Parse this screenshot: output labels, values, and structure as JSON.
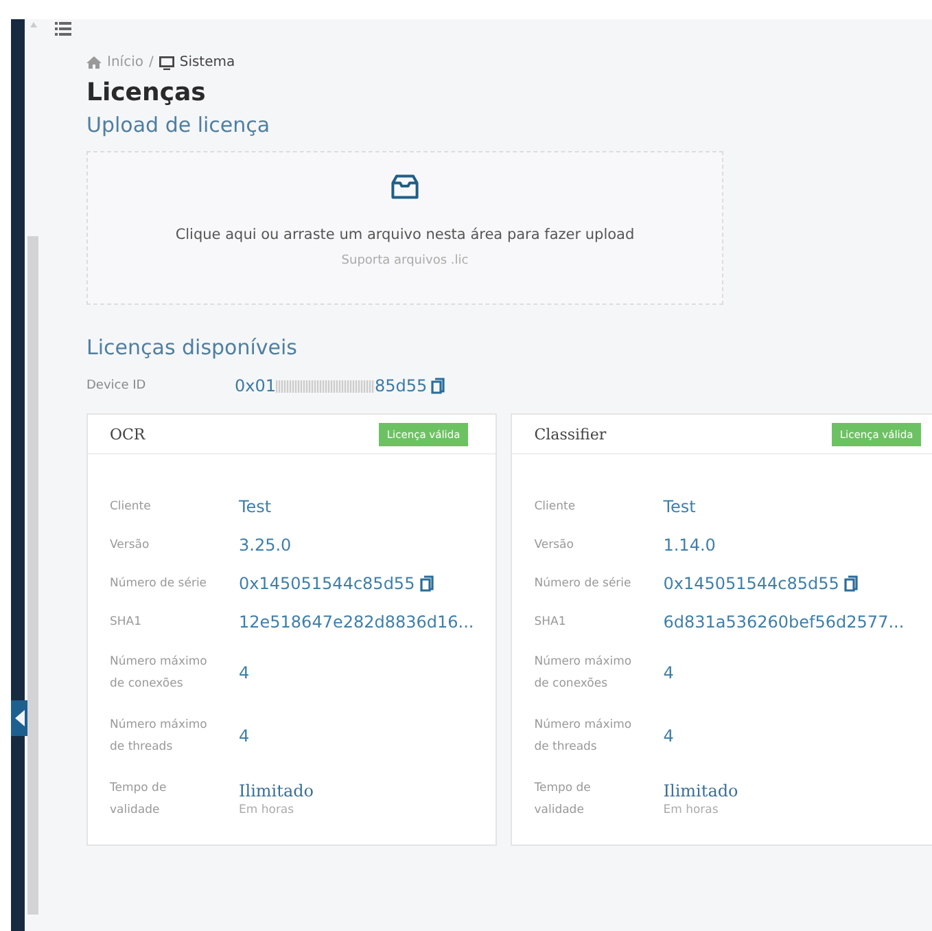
{
  "breadcrumb_separator": "/",
  "breadcrumb": [
    {
      "label": "Início",
      "kind": "home"
    },
    {
      "label": "Sistema",
      "kind": "monitor"
    }
  ],
  "title": "Licenças",
  "upload": {
    "heading": "Upload de licença",
    "prompt": "Clique aqui ou arraste um arquivo nesta área para fazer upload",
    "hint": "Suporta arquivos .lic"
  },
  "licenses": {
    "heading": "Licenças disponíveis",
    "device_id": {
      "label": "Device ID",
      "prefix": "0x01",
      "suffix": "85d55"
    },
    "cards": [
      {
        "name": "OCR",
        "badge": "Licença válida",
        "rows": [
          {
            "label": "Cliente",
            "value": "Test"
          },
          {
            "label": "Versão",
            "value": "3.25.0"
          },
          {
            "label": "Número de série",
            "value": "0x145051544c85d55",
            "copy": true
          },
          {
            "label": "SHA1",
            "value": "12e518647e282d8836d16..."
          },
          {
            "label": "Número máximo de conexões",
            "value": "4"
          },
          {
            "label": "Número máximo de threads",
            "value": "4"
          },
          {
            "label": "Tempo de validade",
            "value": "Ilimitado",
            "note": "Em horas"
          }
        ]
      },
      {
        "name": "Classifier",
        "badge": "Licença válida",
        "rows": [
          {
            "label": "Cliente",
            "value": "Test"
          },
          {
            "label": "Versão",
            "value": "1.14.0"
          },
          {
            "label": "Número de série",
            "value": "0x145051544c85d55",
            "copy": true
          },
          {
            "label": "SHA1",
            "value": "6d831a536260bef56d2577..."
          },
          {
            "label": "Número máximo de conexões",
            "value": "4"
          },
          {
            "label": "Número máximo de threads",
            "value": "4"
          },
          {
            "label": "Tempo de validade",
            "value": "Ilimitado",
            "note": "Em horas"
          }
        ]
      }
    ]
  }
}
